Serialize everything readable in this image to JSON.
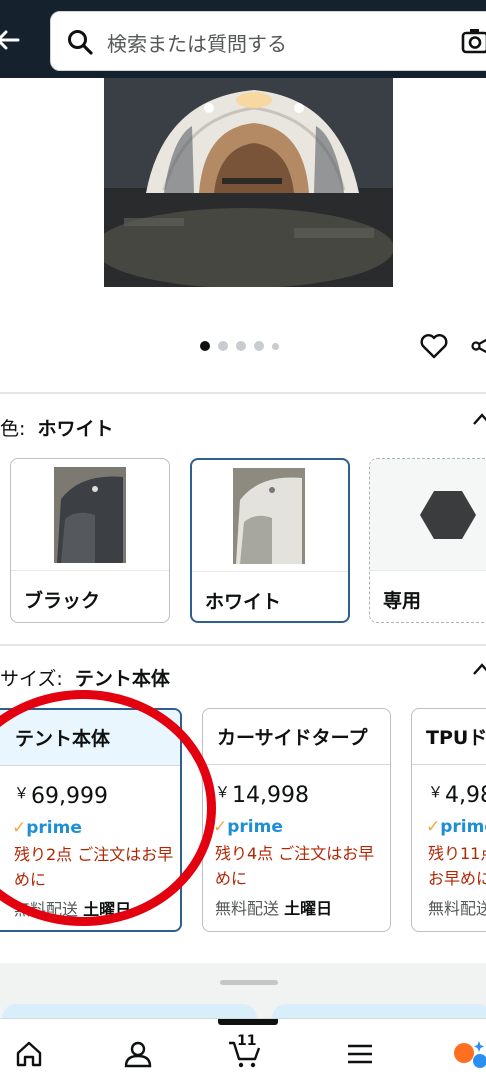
{
  "header": {
    "search_placeholder": "検索または質問する",
    "colors": {
      "background": "#16212e"
    }
  },
  "carousel": {
    "image_description": "white dome tent at night",
    "page_count": 5,
    "active_page": 1
  },
  "color_selector": {
    "label": "色:",
    "selected": "ホワイト",
    "options": [
      {
        "label": "ブラック",
        "selected": false
      },
      {
        "label": "ホワイト",
        "selected": true
      },
      {
        "label": "専用",
        "selected": false
      }
    ]
  },
  "size_selector": {
    "label": "サイズ:",
    "selected": "テント本体",
    "options": [
      {
        "name": "テント本体",
        "yen": "￥",
        "price": "69,999",
        "prime": "prime",
        "stock": "残り2点 ご注文はお早めに",
        "delivery_prefix": "無料配送",
        "delivery_day": "土曜日",
        "selected": true
      },
      {
        "name": "カーサイドタープ",
        "yen": "￥",
        "price": "14,998",
        "prime": "prime",
        "stock": "残り4点 ご注文はお早めに",
        "delivery_prefix": "無料配送",
        "delivery_day": "土曜日",
        "selected": false
      },
      {
        "name": "TPUド",
        "yen": "￥",
        "price": "4,98",
        "prime": "prime",
        "stock": "残り11点 お早めに",
        "delivery_prefix": "無料配送",
        "delivery_day": "",
        "selected": false
      }
    ]
  },
  "bottom_nav": {
    "cart_count": "11",
    "items": [
      "home-icon",
      "account-icon",
      "cart-icon",
      "menu-icon",
      "assistant-icon"
    ]
  },
  "accent_colors": {
    "price_red": "#b12704",
    "prime_blue": "#1e8fd6",
    "selected_border": "#2f5f8c",
    "annotation_red": "#e3000f"
  }
}
